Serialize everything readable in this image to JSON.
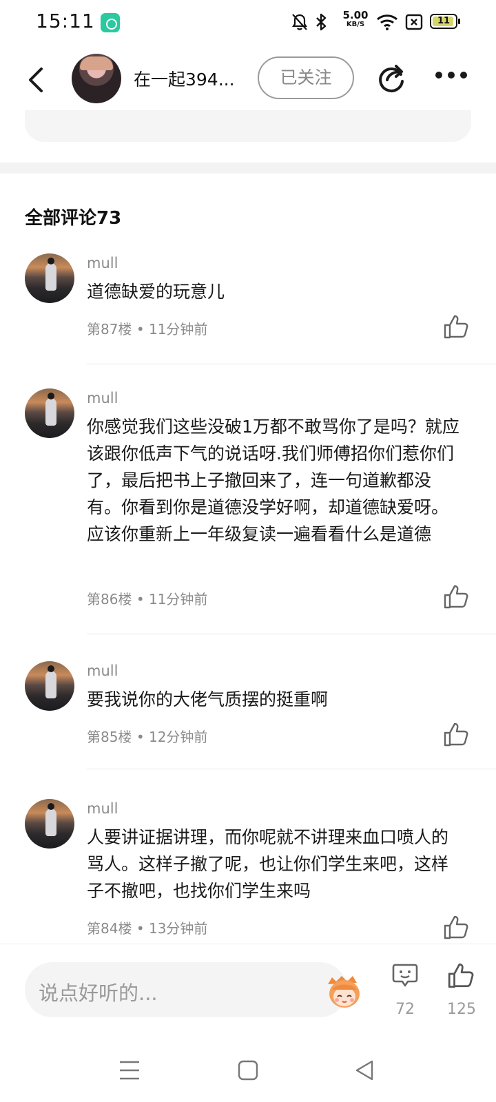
{
  "status_bar": {
    "time": "15:11",
    "speed_value": "5.00",
    "speed_unit": "KB/S",
    "battery_level": "11",
    "icons": [
      "app-notification-icon",
      "mute-bell-icon",
      "bluetooth-icon",
      "wifi-icon",
      "no-sim-icon",
      "battery-icon"
    ]
  },
  "header": {
    "author_name": "在一起394...",
    "follow_label": "已关注",
    "icons": [
      "back-arrow-icon",
      "share-icon",
      "more-dots-icon"
    ]
  },
  "comments_heading": "全部评论73",
  "comments": [
    {
      "user": "mull",
      "text": "道德缺爱的玩意儿",
      "floor": "第87楼",
      "time": "11分钟前"
    },
    {
      "user": "mull",
      "text": "你感觉我们这些没破1万都不敢骂你了是吗？就应该跟你低声下气的说话呀.我们师傅招你们惹你们了，最后把书上子撤回来了，连一句道歉都没有。你看到你是道德没学好啊，却道德缺爱呀。应该你重新上一年级复读一遍看看什么是道德",
      "floor": "第86楼",
      "time": "11分钟前"
    },
    {
      "user": "mull",
      "text": "要我说你的大佬气质摆的挺重啊",
      "floor": "第85楼",
      "time": "12分钟前"
    },
    {
      "user": "mull",
      "text": "人要讲证据讲理，而你呢就不讲理来血口喷人的骂人。这样子撤了呢，也让你们学生来吧，这样子不撤吧，也找你们学生来吗",
      "floor": "第84楼",
      "time": "13分钟前"
    }
  ],
  "meta_separator": "•",
  "bottom_bar": {
    "input_placeholder": "说点好听的...",
    "comment_count": "72",
    "like_count": "125"
  },
  "colors": {
    "follow_border": "#9a9a9a",
    "meta_text": "#8a8a8a",
    "app_icon": "#2cc8a0"
  }
}
